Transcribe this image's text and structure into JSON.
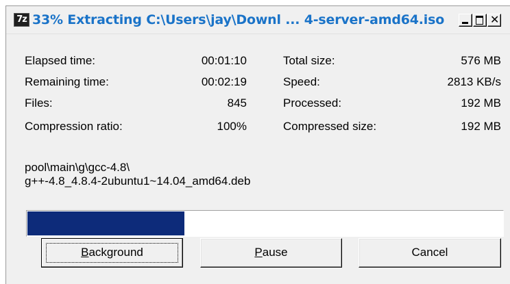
{
  "titlebar": {
    "icon_text": "7z",
    "title": "33% Extracting C:\\Users\\jay\\Downl ... 4-server-amd64.iso"
  },
  "stats": {
    "elapsed_label": "Elapsed time:",
    "elapsed_value": "00:01:10",
    "remaining_label": "Remaining time:",
    "remaining_value": "00:02:19",
    "files_label": "Files:",
    "files_value": "845",
    "ratio_label": "Compression ratio:",
    "ratio_value": "100%",
    "total_size_label": "Total size:",
    "total_size_value": "576 MB",
    "speed_label": "Speed:",
    "speed_value": "2813 KB/s",
    "processed_label": "Processed:",
    "processed_value": "192 MB",
    "compressed_label": "Compressed size:",
    "compressed_value": "192 MB"
  },
  "current_file": {
    "line1": "pool\\main\\g\\gcc-4.8\\",
    "line2": "g++-4.8_4.8.4-2ubuntu1~14.04_amd64.deb"
  },
  "progress": {
    "percent": 33,
    "fill_color": "#0d2b7a"
  },
  "buttons": {
    "background_mnemonic": "B",
    "background_rest": "ackground",
    "pause_mnemonic": "P",
    "pause_rest": "ause",
    "cancel_label": "Cancel"
  }
}
